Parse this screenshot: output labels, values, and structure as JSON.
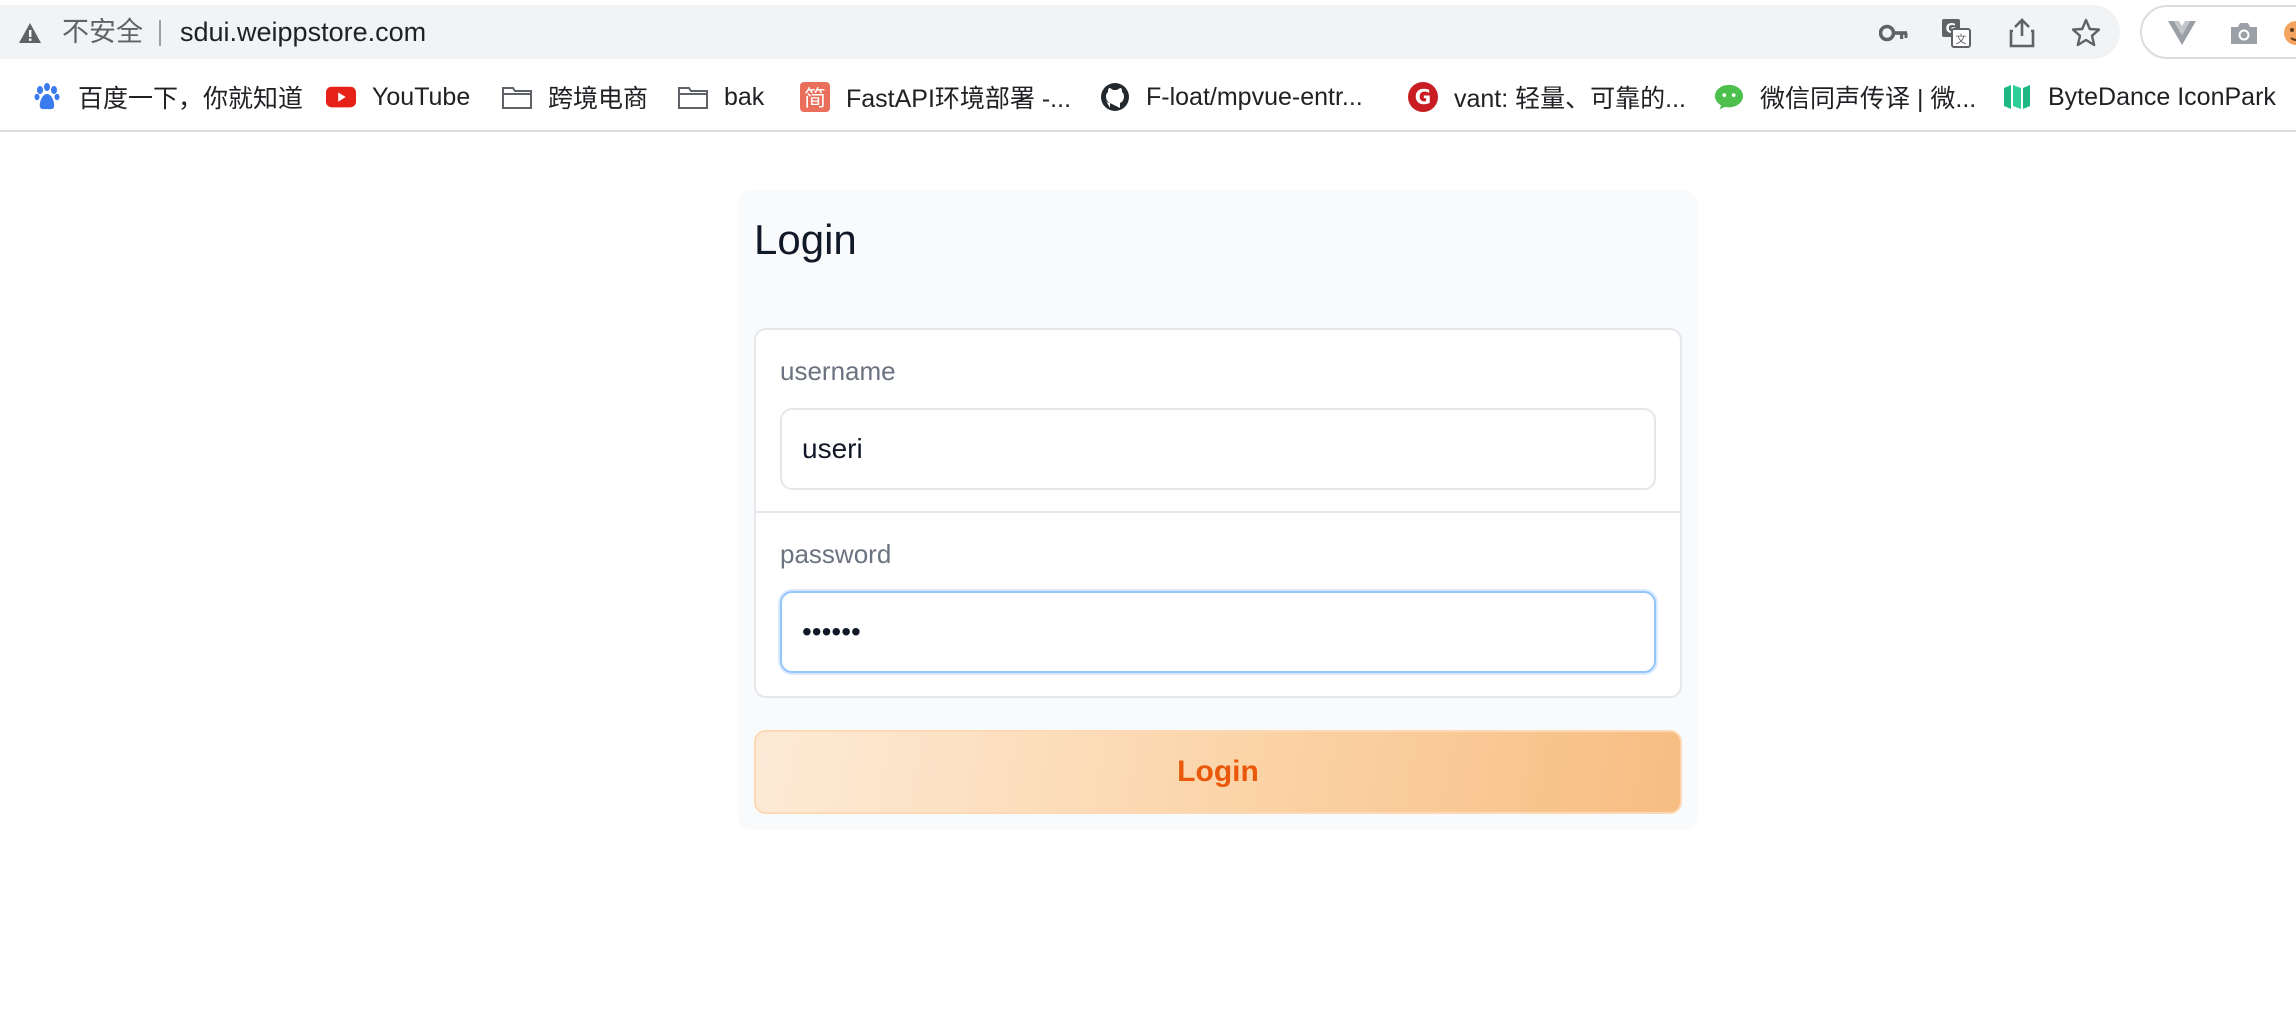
{
  "browser": {
    "security_label": "不安全",
    "url": "sdui.weippstore.com",
    "omnibox_icons": [
      "key-icon",
      "translate-icon",
      "share-icon",
      "star-icon"
    ],
    "extension_icons": [
      "vue-devtools-icon",
      "camera-icon",
      "avatar"
    ]
  },
  "bookmarks": [
    {
      "label": "百度一下，你就知道",
      "icon": "baidu-icon"
    },
    {
      "label": "YouTube",
      "icon": "youtube-icon"
    },
    {
      "label": "跨境电商",
      "icon": "folder-icon"
    },
    {
      "label": "bak",
      "icon": "folder-icon"
    },
    {
      "label": "FastAPI环境部署 -...",
      "icon": "jianshu-icon",
      "icon_text": "简"
    },
    {
      "label": "F-loat/mpvue-entr...",
      "icon": "github-icon"
    },
    {
      "label": "vant: 轻量、可靠的...",
      "icon": "gitee-icon",
      "icon_text": "G"
    },
    {
      "label": "微信同声传译 | 微...",
      "icon": "wechat-icon"
    },
    {
      "label": "ByteDance IconPark",
      "icon": "iconpark-icon"
    }
  ],
  "login": {
    "title": "Login",
    "username_label": "username",
    "username_value": "useri",
    "password_label": "password",
    "password_value": "••••••",
    "button_label": "Login"
  },
  "colors": {
    "accent_text": "#ea580c",
    "button_gradient_start": "#fdebd7",
    "button_gradient_end": "#f7bd82",
    "focus_border": "#93c5fd"
  }
}
